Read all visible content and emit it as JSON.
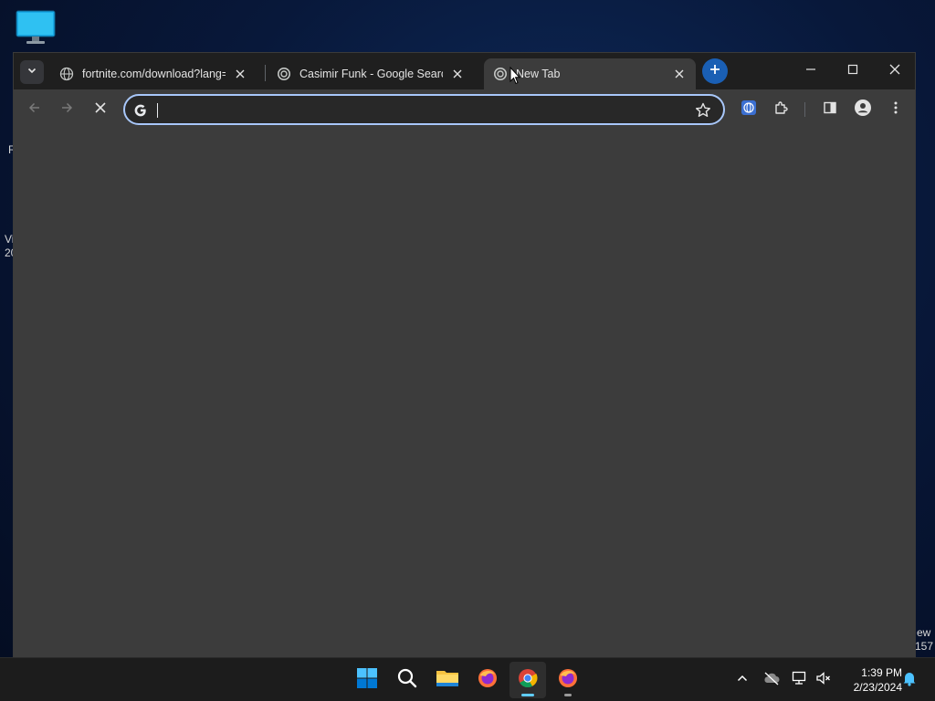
{
  "desktop": {
    "icon": "this-pc-monitor-icon",
    "edge_texts": [
      "R",
      "Vi",
      "20",
      "ew",
      "157"
    ]
  },
  "browser": {
    "tabs": [
      {
        "title": "fortnite.com/download?lang=e",
        "favicon": "globe-icon",
        "active": false
      },
      {
        "title": "Casimir Funk - Google Search",
        "favicon": "loading-spinner-icon",
        "active": false
      },
      {
        "title": "New Tab",
        "favicon": "loading-spinner-icon",
        "active": true
      }
    ],
    "omnibox": {
      "value": "",
      "placeholder": ""
    },
    "colors": {
      "accent": "#1a5fb4",
      "omnibox_border": "#a8c7fa",
      "toolbar": "#3c3c3c",
      "tabstrip": "#1f1f1f"
    }
  },
  "taskbar": {
    "apps": [
      "windows-start-icon",
      "search-icon",
      "file-explorer-icon",
      "firefox-icon",
      "chrome-icon",
      "firefox-icon"
    ],
    "clock": {
      "time": "1:39 PM",
      "date": "2/23/2024"
    }
  }
}
